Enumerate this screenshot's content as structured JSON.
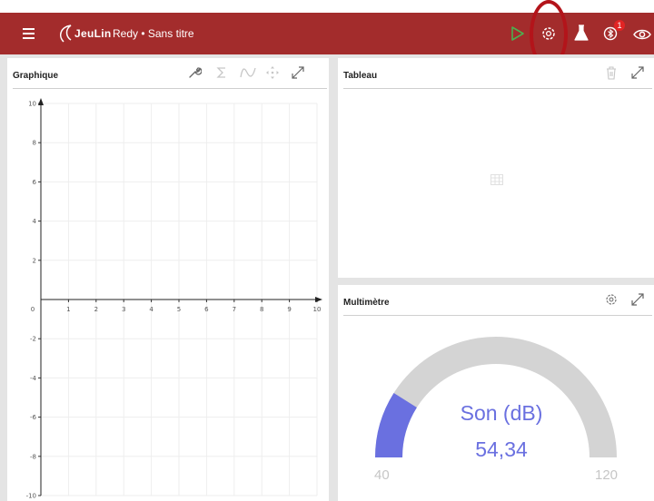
{
  "header": {
    "brand": "JeuLin",
    "title": "Redy • Sans titre",
    "notification_count": "1",
    "colors": {
      "bar": "#a32c2c",
      "play": "#4caf50",
      "ring": "#b3141a"
    },
    "icons": [
      "menu-icon",
      "play-icon",
      "settings-icon",
      "flask-icon",
      "bluetooth-icon",
      "eye-icon"
    ]
  },
  "graph": {
    "title": "Graphique",
    "icons": [
      "wrench-icon",
      "sigma-icon",
      "curve-icon",
      "move-icon",
      "expand-icon"
    ],
    "x_ticks": [
      "0",
      "1",
      "2",
      "3",
      "4",
      "5",
      "6",
      "7",
      "8",
      "9",
      "10"
    ],
    "y_ticks": [
      "10",
      "8",
      "6",
      "4",
      "2",
      "-2",
      "-4",
      "-6",
      "-8",
      "-10"
    ],
    "x_range": [
      0,
      10
    ],
    "y_range": [
      -10,
      10
    ]
  },
  "table": {
    "title": "Tableau",
    "icons": [
      "trash-icon",
      "expand-icon",
      "grid-icon"
    ]
  },
  "meter": {
    "title": "Multimètre",
    "label": "Son (dB)",
    "value_text": "54,34",
    "min_label": "40",
    "max_label": "120",
    "min": 40,
    "max": 120,
    "value": 54.34,
    "colors": {
      "fill": "#6a70e0",
      "track": "#d4d4d4"
    },
    "icons": [
      "settings-icon",
      "expand-icon"
    ]
  }
}
